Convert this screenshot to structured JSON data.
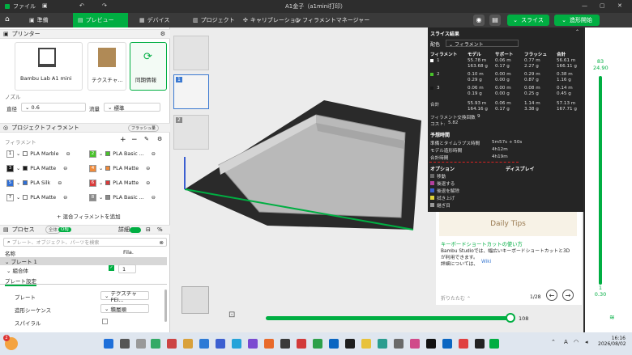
{
  "window": {
    "menu_file": "ファイル",
    "title": "A1金子（a1mini打印）"
  },
  "toolbar": {
    "tabs": [
      {
        "label": "準備",
        "active": false
      },
      {
        "label": "プレビュー",
        "active": true
      },
      {
        "label": "デバイス",
        "active": false
      },
      {
        "label": "プロジェクト",
        "active": false
      },
      {
        "label": "キャリブレーション",
        "active": false
      },
      {
        "label": "フィラメントマネージャー",
        "active": false
      }
    ],
    "slice_button": "スライス",
    "print_button": "造形開始"
  },
  "printer": {
    "section_title": "プリンター",
    "printer_name": "Bambu Lab A1 mini",
    "plate_name": "テクスチャ...",
    "sync_label": "同期情報",
    "nozzle_label": "ノズル",
    "diameter_label": "直径",
    "diameter_value": "0.6",
    "flow_label": "流量",
    "flow_value": "標準"
  },
  "project_filament": {
    "section_title": "プロジェクトフィラメント",
    "badge": "フラッシュ量",
    "filament_label": "フィラメント",
    "left": [
      {
        "num": "1",
        "color": "#ffffff",
        "name": "PLA Marble"
      },
      {
        "num": "3",
        "color": "#1a1a1a",
        "name": "PLA Matte"
      },
      {
        "num": "5",
        "color": "#2f6fd6",
        "name": "PLA Silk"
      },
      {
        "num": "7",
        "color": "#ffffff",
        "name": "PLA Matte"
      }
    ],
    "right": [
      {
        "num": "2",
        "color": "#49c22b",
        "name": "PLA Basic ..."
      },
      {
        "num": "4",
        "color": "#f08a3a",
        "name": "PLA Matte"
      },
      {
        "num": "6",
        "color": "#d93b3b",
        "name": "PLA Matte"
      },
      {
        "num": "8",
        "color": "#8a8a8a",
        "name": "PLA Basic ..."
      }
    ],
    "add_mixed": "+ 混合フィラメントを追加"
  },
  "process": {
    "section_title": "プロセス",
    "global": "全体",
    "objects": "OBJ",
    "detail": "詳細",
    "search_placeholder": "プレート、オブジェクト、パーツを検索",
    "col_name": "名称",
    "col_fila": "Fila.",
    "plate_row": "プレート 1",
    "assembly_row": "組合体",
    "assembly_value": "1",
    "plate_settings_tab": "プレート設定",
    "plate_label": "プレート",
    "plate_value": "テクスチャ PEI...",
    "sequence_label": "造形シーケンス",
    "sequence_value": "積層順",
    "spiral_label": "スパイラル"
  },
  "results": {
    "title": "スライス結果",
    "color_scheme_label": "配色",
    "color_scheme_value": "フィラメント",
    "headers": [
      "フィラメント",
      "モデル",
      "サポート",
      "フラッシュ",
      "合計"
    ],
    "rows": [
      {
        "id": "1",
        "color": "#ffffff",
        "model": "55.78 m",
        "model2": "163.68 g",
        "support": "0.06 m",
        "support2": "0.17 g",
        "flush": "0.77 m",
        "flush2": "2.27 g",
        "total": "56.61 m",
        "total2": "166.11 g"
      },
      {
        "id": "2",
        "color": "#49c22b",
        "model": "0.10 m",
        "model2": "0.29 g",
        "support": "0.00 m",
        "support2": "0.00 g",
        "flush": "0.29 m",
        "flush2": "0.87 g",
        "total": "0.38 m",
        "total2": "1.16 g"
      },
      {
        "id": "3",
        "color": "#1a1a1a",
        "model": "0.06 m",
        "model2": "0.19 g",
        "support": "0.00 m",
        "support2": "0.00 g",
        "flush": "0.08 m",
        "flush2": "0.25 g",
        "total": "0.14 m",
        "total2": "0.45 g"
      }
    ],
    "sum_label": "合計",
    "sum": {
      "model": "55.93 m",
      "model2": "164.16 g",
      "support": "0.06 m",
      "support2": "0.17 g",
      "flush": "1.14 m",
      "flush2": "3.38 g",
      "total": "57.13 m",
      "total2": "167.71 g"
    },
    "change_count_label": "フィラメント交換回数",
    "change_count": "9",
    "cost_label": "コスト:",
    "cost": "5.82",
    "estimate_title": "予想時間",
    "prep_label": "準備とタイムラプス時間",
    "prep_value": "5m57s + 50s",
    "model_time_label": "モデル造形時間",
    "model_time_value": "4h12m",
    "total_time_label": "合計時間",
    "total_time_value": "4h19m",
    "options_title": "オプション",
    "display_title": "ディスプレイ",
    "options": [
      {
        "label": "移動",
        "color": "#6a6a6a"
      },
      {
        "label": "後退する",
        "color": "#b3409d"
      },
      {
        "label": "後退を解除",
        "color": "#3b5fd1"
      },
      {
        "label": "拭き上げ",
        "color": "#e0d43a"
      },
      {
        "label": "継ぎ目",
        "color": "#9a9a9a"
      }
    ]
  },
  "tips": {
    "link_title": "キーボードショートカットの使い方",
    "body": "Bambu Studioでは、幅広いキーボードショートカットと3D",
    "body2": "が利用できます。",
    "body3": "詳細については、",
    "wiki": "Wiki",
    "collapse": "折りたたむ",
    "page": "1/28",
    "image_text": "Daily Tips"
  },
  "slider": {
    "top_value": "83",
    "top_height": "24.90",
    "bottom_value": "1",
    "bottom_height": "0.30",
    "horizontal_value": "108"
  },
  "taskbar": {
    "time": "16:16",
    "date": "2026/08/02",
    "lang": "A",
    "notify": "2"
  }
}
